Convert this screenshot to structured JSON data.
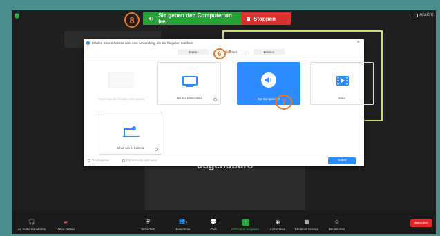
{
  "colors": {
    "share_green": "#25a337",
    "stop_red": "#d8312f",
    "accent_blue": "#2d8cff",
    "annotation_orange": "#f07623",
    "active_speaker_border": "#c8e06a"
  },
  "top_bar": {
    "view_label": "Ansicht",
    "share_status": "Sie geben den Computerton frei",
    "stop_label": "Stoppen"
  },
  "annotations": {
    "step8": "8",
    "step6": "6",
    "step7": "7"
  },
  "participant": {
    "name": "Jugendbüro"
  },
  "dialog": {
    "title": "Wählen Sie ein Fenster oder eine Anwendung, die Sie freigeben möchten.",
    "tabs": [
      "Basis",
      "Erweitert",
      "Dateien"
    ],
    "active_tab": "Erweitert",
    "options": [
      {
        "label": "PowerPoint als virtueller Hintergrund",
        "state": "disabled",
        "icon": "powerpoint-icon"
      },
      {
        "label": "Teil des Bildschirms",
        "state": "normal",
        "icon": "screen-portion-icon"
      },
      {
        "label": "Nur Computerton",
        "state": "selected",
        "icon": "speaker-icon"
      },
      {
        "label": "Video",
        "state": "normal",
        "icon": "film-icon"
      },
      {
        "label": "Inhalt von 2. Kamera",
        "state": "normal",
        "icon": "camera-icon"
      }
    ],
    "footer": {
      "check1": "Ton freigeben",
      "check2": "Für Videoclip optimieren",
      "share_button": "Teilen"
    }
  },
  "toolbar": {
    "items": [
      {
        "label": "An Audio teilnehmen",
        "icon": "headphones-icon"
      },
      {
        "label": "Video starten",
        "icon": "video-off-icon"
      },
      {
        "label": "Sicherheit",
        "icon": "shield-icon"
      },
      {
        "label": "Teilnehmer",
        "icon": "participants-icon",
        "count": "3"
      },
      {
        "label": "Chat",
        "icon": "chat-icon"
      },
      {
        "label": "Bildschirm freigeben",
        "icon": "share-screen-icon"
      },
      {
        "label": "Aufnehmen",
        "icon": "record-icon"
      },
      {
        "label": "Breakout Session",
        "icon": "breakout-icon"
      },
      {
        "label": "Reaktionen",
        "icon": "reactions-icon"
      }
    ],
    "end_label": "Beenden"
  }
}
